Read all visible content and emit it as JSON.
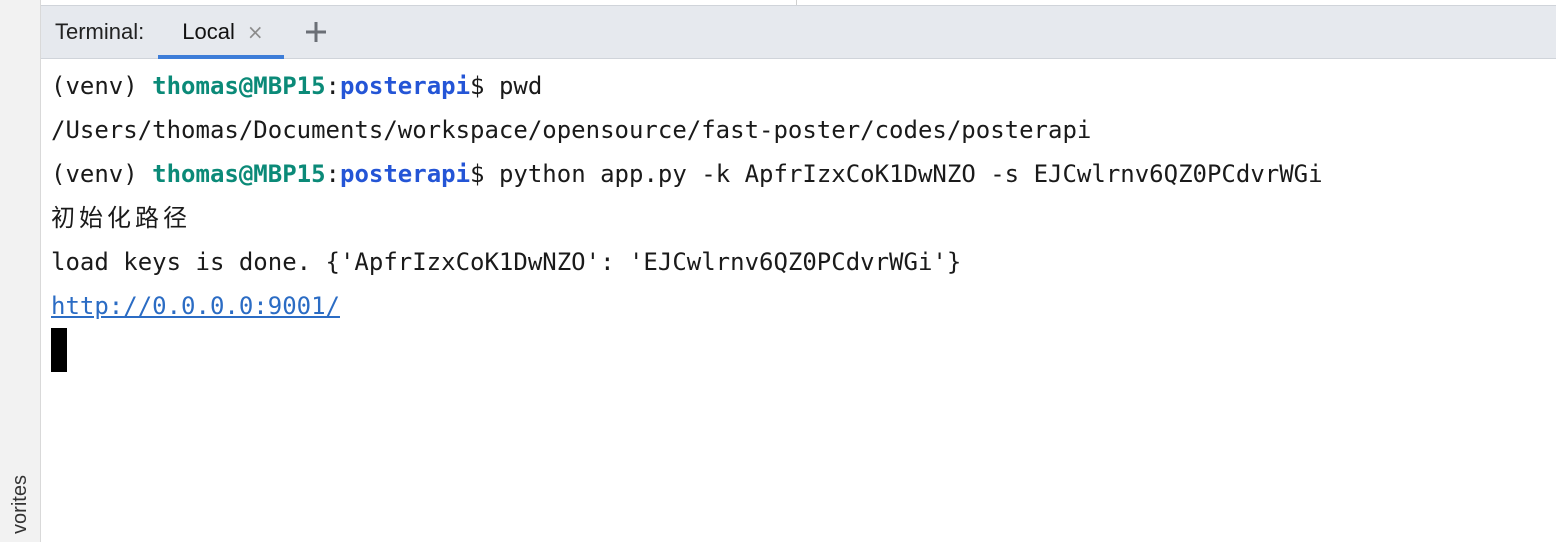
{
  "sidebar": {
    "vertical_tab_label": "vorites"
  },
  "tabbar": {
    "label": "Terminal:",
    "tabs": [
      {
        "label": "Local",
        "active": true
      }
    ],
    "close_glyph": "×",
    "add_icon": "plus-icon"
  },
  "terminal": {
    "lines": [
      {
        "venv": "(venv) ",
        "user": "thomas@MBP15",
        "sep": ":",
        "dir": "posterapi",
        "prompt": "$ ",
        "cmd": "pwd"
      },
      {
        "text": "/Users/thomas/Documents/workspace/opensource/fast-poster/codes/posterapi"
      },
      {
        "venv": "(venv) ",
        "user": "thomas@MBP15",
        "sep": ":",
        "dir": "posterapi",
        "prompt": "$ ",
        "cmd": "python app.py -k ApfrIzxCoK1DwNZO -s EJCwlrnv6QZ0PCdvrWGi"
      },
      {
        "text": "初始化路径"
      },
      {
        "text": "load keys is done. {'ApfrIzxCoK1DwNZO': 'EJCwlrnv6QZ0PCdvrWGi'}"
      },
      {
        "link": "http://0.0.0.0:9001/"
      }
    ]
  },
  "colors": {
    "user": "#0b8a78",
    "dir": "#2455d6",
    "link": "#2b6cc4",
    "tab_underline": "#3d7dd8",
    "tabbar_bg": "#e6e9ee"
  }
}
